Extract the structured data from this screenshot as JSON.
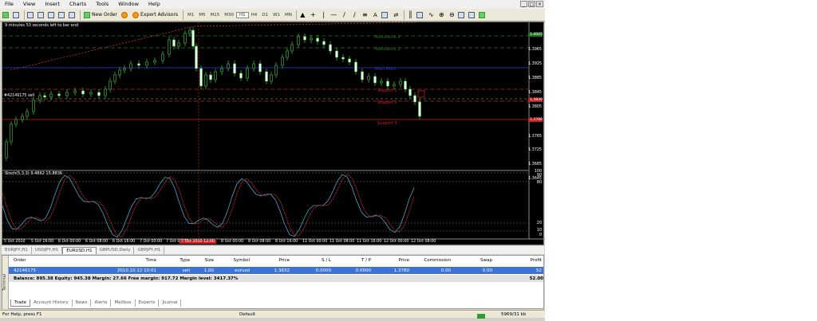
{
  "menu": [
    "File",
    "View",
    "Insert",
    "Charts",
    "Tools",
    "Window",
    "Help"
  ],
  "window_buttons": [
    "_",
    "□",
    "×"
  ],
  "toolbar": {
    "new_order": "New Order",
    "expert_advisors": "Expert Advisors",
    "timeframes": [
      "M1",
      "M5",
      "M15",
      "M30",
      "H1",
      "H4",
      "D1",
      "W1",
      "MN"
    ],
    "draw_tool_label": "A"
  },
  "chart": {
    "timer_text": "9 minutes 53 seconds left to bar end",
    "stoch_label": "Stoch(5,3,3) 9.4862 15.8836",
    "order_tag": "#42146175 sell",
    "levels": [
      {
        "name": "Resistance 2",
        "color": "#1e7a1e"
      },
      {
        "name": "Resistance 1",
        "color": "#1e7a1e"
      },
      {
        "name": "Pivot Point",
        "color": "#2244dd"
      },
      {
        "name": "Support 1",
        "color": "#cc2020"
      },
      {
        "name": "Support 2",
        "color": "#cc2020"
      },
      {
        "name": "Support 3",
        "color": "#cc2020"
      }
    ],
    "price_axis": [
      "1.3965",
      "1.3925",
      "1.3885",
      "1.3845",
      "1.3805",
      "1.3765",
      "1.3725",
      "1.3685",
      "1.3645"
    ],
    "price_tags": [
      {
        "text": "1.4005",
        "color": "#1e7a1e"
      },
      {
        "text": "1.3830",
        "color": "#cc2020"
      },
      {
        "text": "1.3780",
        "color": "#cc2020"
      }
    ],
    "stoch_axis": [
      "100",
      "90",
      "80",
      "20",
      "10",
      "0"
    ],
    "time_axis": [
      "5 Oct 2010",
      "5 Oct 16:00",
      "6 Oct 00:00",
      "6 Oct 08:00",
      "6 Oct 16:00",
      "7 Oct 00:00",
      "7 Oct 08:00",
      "8 Oct 00:00",
      "8 Oct 08:00",
      "8 Oct 16:00",
      "11 Oct 00:00",
      "11 Oct 08:00",
      "11 Oct 16:00",
      "12 Oct 00:00",
      "12 Oct 08:00"
    ],
    "time_highlight": "7 Oct 2010 12:00"
  },
  "chart_tabs": [
    "EURJPY,H1",
    "USDJPY,H1",
    "EURUSD,H1",
    "GBPUSD,Daily",
    "GBPJPY,H1"
  ],
  "active_chart_tab": "EURUSD,H1",
  "terminal": {
    "side_caption": "Terminal",
    "columns": {
      "order": "Order",
      "time": "Time",
      "type": "Type",
      "size": "Size",
      "symbol": "Symbol",
      "price": "Price",
      "sl": "S / L",
      "tp": "T / P",
      "price2": "Price",
      "commission": "Commission",
      "swap": "Swap",
      "profit": "Profit"
    },
    "row": {
      "order": "42146175",
      "time": "2010.10.12 10:01",
      "type": "sell",
      "size": "1.00",
      "symbol": "eurusd",
      "price": "1.3832",
      "sl": "0.0000",
      "tp": "0.0000",
      "price2": "1.3780",
      "commission": "0.00",
      "swap": "0.00",
      "profit": "52"
    },
    "balance_text": "Balance: 895.38  Equity: 945.38  Margin: 27.66  Free margin: 917.72  Margin level: 3417.37%",
    "balance_profit": "52.00",
    "tabs": [
      "Trade",
      "Account History",
      "News",
      "Alerts",
      "Mailbox",
      "Experts",
      "Journal"
    ],
    "active_tab": "Trade"
  },
  "status": {
    "help": "For Help, press F1",
    "profile": "Default",
    "traffic": "5969/31 kb"
  }
}
